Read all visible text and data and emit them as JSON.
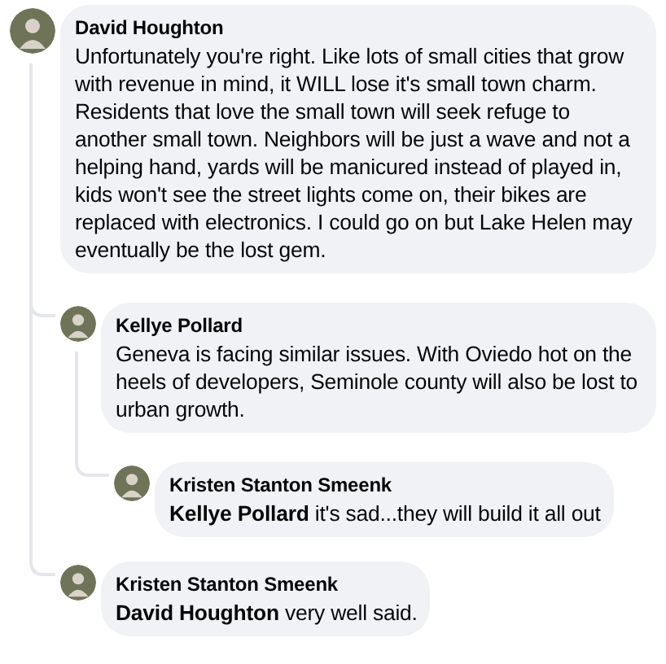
{
  "comments": [
    {
      "author": "David Houghton",
      "text": "Unfortunately you're right. Like lots of small cities that grow with revenue in mind, it WILL lose it's small town charm. Residents that love the small town will seek refuge to another small town. Neighbors will be just a wave and not a helping hand, yards will be manicured instead of played in, kids won't see the street lights come on, their bikes are replaced with electronics. I could go on but Lake Helen may eventually be the lost gem.",
      "children": [
        {
          "author": "Kellye Pollard",
          "text": "Geneva is facing similar issues. With Oviedo hot on the heels of developers, Seminole county will also be lost to urban growth.",
          "children": [
            {
              "author": "Kristen Stanton Smeenk",
              "text": "**Kellye Pollard** it's sad...they will build it all out"
            }
          ]
        },
        {
          "author": "Kristen Stanton Smeenk",
          "text": "**David Houghton** very well said."
        }
      ]
    }
  ]
}
